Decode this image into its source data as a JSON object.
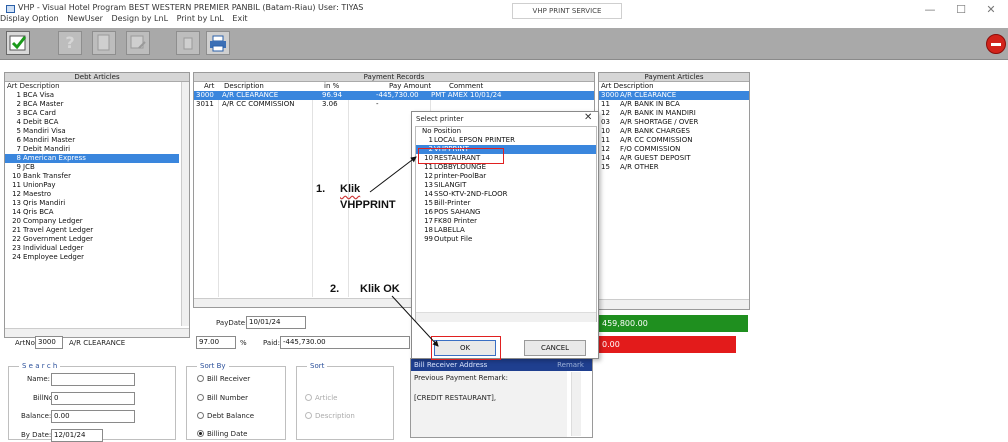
{
  "window": {
    "title": "VHP - Visual Hotel Program     BEST WESTERN PREMIER PANBIL (Batam-Riau) User: TIYAS",
    "print_service": "VHP PRINT SERVICE",
    "minimize": "—",
    "maximize": "☐",
    "close": "✕"
  },
  "menu": [
    "Display Option",
    "NewUser",
    "Design by LnL",
    "Print by LnL",
    "Exit"
  ],
  "toolbar": {
    "help": "?"
  },
  "debt_articles": {
    "header": "Debt Articles",
    "col_art": "Art",
    "col_desc": "Description",
    "rows": [
      {
        "art": "1",
        "desc": "BCA Visa"
      },
      {
        "art": "2",
        "desc": "BCA Master"
      },
      {
        "art": "3",
        "desc": "BCA Card"
      },
      {
        "art": "4",
        "desc": "Debit BCA"
      },
      {
        "art": "5",
        "desc": "Mandiri Visa"
      },
      {
        "art": "6",
        "desc": "Mandiri Master"
      },
      {
        "art": "7",
        "desc": "Debit Mandiri"
      },
      {
        "art": "8",
        "desc": "American Express"
      },
      {
        "art": "9",
        "desc": "JCB"
      },
      {
        "art": "10",
        "desc": "Bank Transfer"
      },
      {
        "art": "11",
        "desc": "UnionPay"
      },
      {
        "art": "12",
        "desc": "Maestro"
      },
      {
        "art": "13",
        "desc": "Qris Mandiri"
      },
      {
        "art": "14",
        "desc": "Qris BCA"
      },
      {
        "art": "20",
        "desc": "Company Ledger"
      },
      {
        "art": "21",
        "desc": "Travel Agent Ledger"
      },
      {
        "art": "22",
        "desc": "Government Ledger"
      },
      {
        "art": "23",
        "desc": "Individual Ledger"
      },
      {
        "art": "24",
        "desc": "Employee Ledger"
      }
    ]
  },
  "payment_records": {
    "header": "Payment Records",
    "col_art": "Art",
    "col_desc": "Description",
    "col_pct": "in %",
    "col_pay": "Pay Amount",
    "col_comment": "Comment",
    "rows": [
      {
        "art": "3000",
        "desc": "A/R CLEARANCE",
        "pct": "96.94",
        "pay": "-445,730.00",
        "comment": "PMT AMEX 10/01/24"
      },
      {
        "art": "3011",
        "desc": "A/R CC COMMISSION",
        "pct": "3.06",
        "pay": "-",
        "comment": ""
      }
    ]
  },
  "payment_articles": {
    "header": "Payment Articles",
    "col_art": "Art",
    "col_desc": "Description",
    "rows": [
      {
        "art": "3000",
        "desc": "A/R CLEARANCE"
      },
      {
        "art": "11",
        "desc": "A/R BANK IN BCA"
      },
      {
        "art": "12",
        "desc": "A/R BANK IN MANDIRI"
      },
      {
        "art": "03",
        "desc": "A/R SHORTAGE / OVER"
      },
      {
        "art": "10",
        "desc": "A/R BANK CHARGES"
      },
      {
        "art": "11",
        "desc": "A/R CC COMMISSION"
      },
      {
        "art": "12",
        "desc": "F/O COMMISSION"
      },
      {
        "art": "14",
        "desc": "A/R GUEST DEPOSIT"
      },
      {
        "art": "15",
        "desc": "A/R OTHER"
      }
    ]
  },
  "totals": {
    "green": "459,800.00",
    "red": "0.00"
  },
  "artno": {
    "label": "ArtNo:",
    "value": "3000",
    "desc": "A/R CLEARANCE"
  },
  "payment": {
    "paydate_label": "PayDate:",
    "paydate": "10/01/24",
    "pct_value": "97.00",
    "pct_sign": "%",
    "paid_label": "Paid:",
    "paid_value": "-445,730.00"
  },
  "search": {
    "title": "S e a r c h",
    "name_label": "Name:",
    "name_value": "",
    "billno_label": "BillNo:",
    "billno_value": "0",
    "balance_label": "Balance:",
    "balance_value": "0.00",
    "bydate_label": "By Date:",
    "bydate_value": "12/01/24"
  },
  "sort_by": {
    "title": "Sort By",
    "options": [
      "Bill Receiver",
      "Bill Number",
      "Debt Balance",
      "Billing Date"
    ],
    "selected": "Billing Date"
  },
  "sort": {
    "title": "Sort",
    "options": [
      "Article",
      "Description"
    ]
  },
  "remark": {
    "header": "Bill Receiver Address",
    "tab": "Remark",
    "label": "Previous Payment Remark:",
    "text": "[CREDIT RESTAURANT],"
  },
  "printer_dialog": {
    "title": "Select printer",
    "close": "✕",
    "col_no": "No",
    "col_pos": "Position",
    "printers": [
      {
        "no": "1",
        "name": "LOCAL EPSON PRINTER"
      },
      {
        "no": "2",
        "name": "VHPPRINT"
      },
      {
        "no": "10",
        "name": "RESTAURANT"
      },
      {
        "no": "11",
        "name": "LOBBYLOUNGE"
      },
      {
        "no": "12",
        "name": "printer-PoolBar"
      },
      {
        "no": "13",
        "name": "SILANGIT"
      },
      {
        "no": "14",
        "name": "SSO-KTV-2ND-FLOOR"
      },
      {
        "no": "15",
        "name": "Bill-Printer"
      },
      {
        "no": "16",
        "name": "POS SAHANG"
      },
      {
        "no": "17",
        "name": "FK80 Printer"
      },
      {
        "no": "18",
        "name": "LABELLA"
      },
      {
        "no": "99",
        "name": "Output File"
      }
    ],
    "selected": "VHPPRINT",
    "ok": "OK",
    "cancel": "CANCEL"
  },
  "annotations": {
    "step1_num": "1.",
    "step1_word": "Klik",
    "step1_target": "VHPPRINT",
    "step2_num": "2.",
    "step2_text": "Klik OK"
  },
  "colors": {
    "selection": "#3a86dd",
    "toolbar": "#a9a9a9",
    "green": "#1f8f1f",
    "red": "#e31b1b",
    "annotation_box": "#e02020"
  }
}
